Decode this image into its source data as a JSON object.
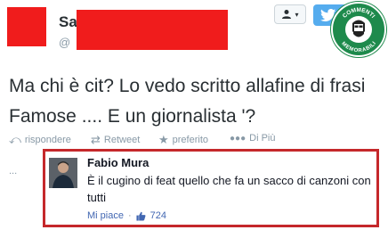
{
  "tweet": {
    "author_initial": "Sa",
    "handle_initial": "@",
    "text": "Ma chi è cit? Lo vedo scritto allafine di frasi Famose .... E un giornalista '?",
    "actions": {
      "reply": "rispondere",
      "retweet": "Retweet",
      "favorite": "preferito",
      "more": "Di Più"
    },
    "overflow_dots": "..."
  },
  "header": {
    "follow_icon": "person-icon",
    "twitter_icon": "twitter-bird-icon",
    "badge_text_top": "COMMENTI",
    "badge_text_bottom": "MEMORABILI"
  },
  "comment": {
    "author": "Fabio Mura",
    "text": "È il cugino di feat quello che fa un sacco di canzoni con tutti",
    "like_label": "Mi piace",
    "separator": "·",
    "like_count": "724",
    "like_icon": "thumbs-up-icon"
  },
  "colors": {
    "redaction": "#f01c1c",
    "highlight_border": "#c5282b",
    "twitter_blue": "#55acee",
    "badge_green": "#1e8a4c",
    "muted": "#8899a6"
  }
}
